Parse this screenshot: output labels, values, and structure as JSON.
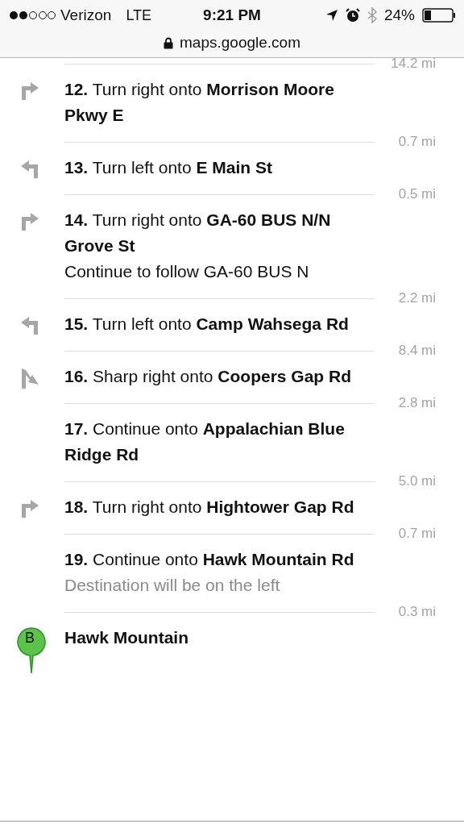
{
  "status_bar": {
    "carrier": "Verizon",
    "network": "LTE",
    "time": "9:21 PM",
    "battery": "24%"
  },
  "address_bar": {
    "url": "maps.google.com"
  },
  "first_distance": "14.2 mi",
  "steps": [
    {
      "kind": "right",
      "text": "**12.** Turn right onto **Morrison Moore Pkwy E**",
      "distance": "0.7 mi"
    },
    {
      "kind": "left",
      "text": "**13.** Turn left onto **E Main St**",
      "distance": "0.5 mi"
    },
    {
      "kind": "right",
      "text": "**14.** Turn right onto **GA-60 BUS N/N Grove St**",
      "note": {
        "kind": "plain",
        "text": "Continue to follow GA-60 BUS N"
      },
      "distance": "2.2 mi"
    },
    {
      "kind": "left",
      "text": "**15.** Turn left onto **Camp Wahsega Rd**",
      "distance": "8.4 mi"
    },
    {
      "kind": "sharp_right",
      "text": "**16.** Sharp right onto **Coopers Gap Rd**",
      "distance": "2.8 mi"
    },
    {
      "kind": "straight",
      "text": "**17.** Continue onto **Appalachian Blue Ridge Rd**",
      "distance": "5.0 mi"
    },
    {
      "kind": "right",
      "text": "**18.** Turn right onto **Hightower Gap Rd**",
      "distance": "0.7 mi"
    },
    {
      "kind": "straight",
      "text": "**19.** Continue onto **Hawk Mountain Rd**",
      "note": {
        "kind": "muted",
        "text": "Destination will be on the left"
      },
      "distance": "0.3 mi"
    }
  ],
  "destination": {
    "marker": "B",
    "name": "Hawk Mountain"
  }
}
